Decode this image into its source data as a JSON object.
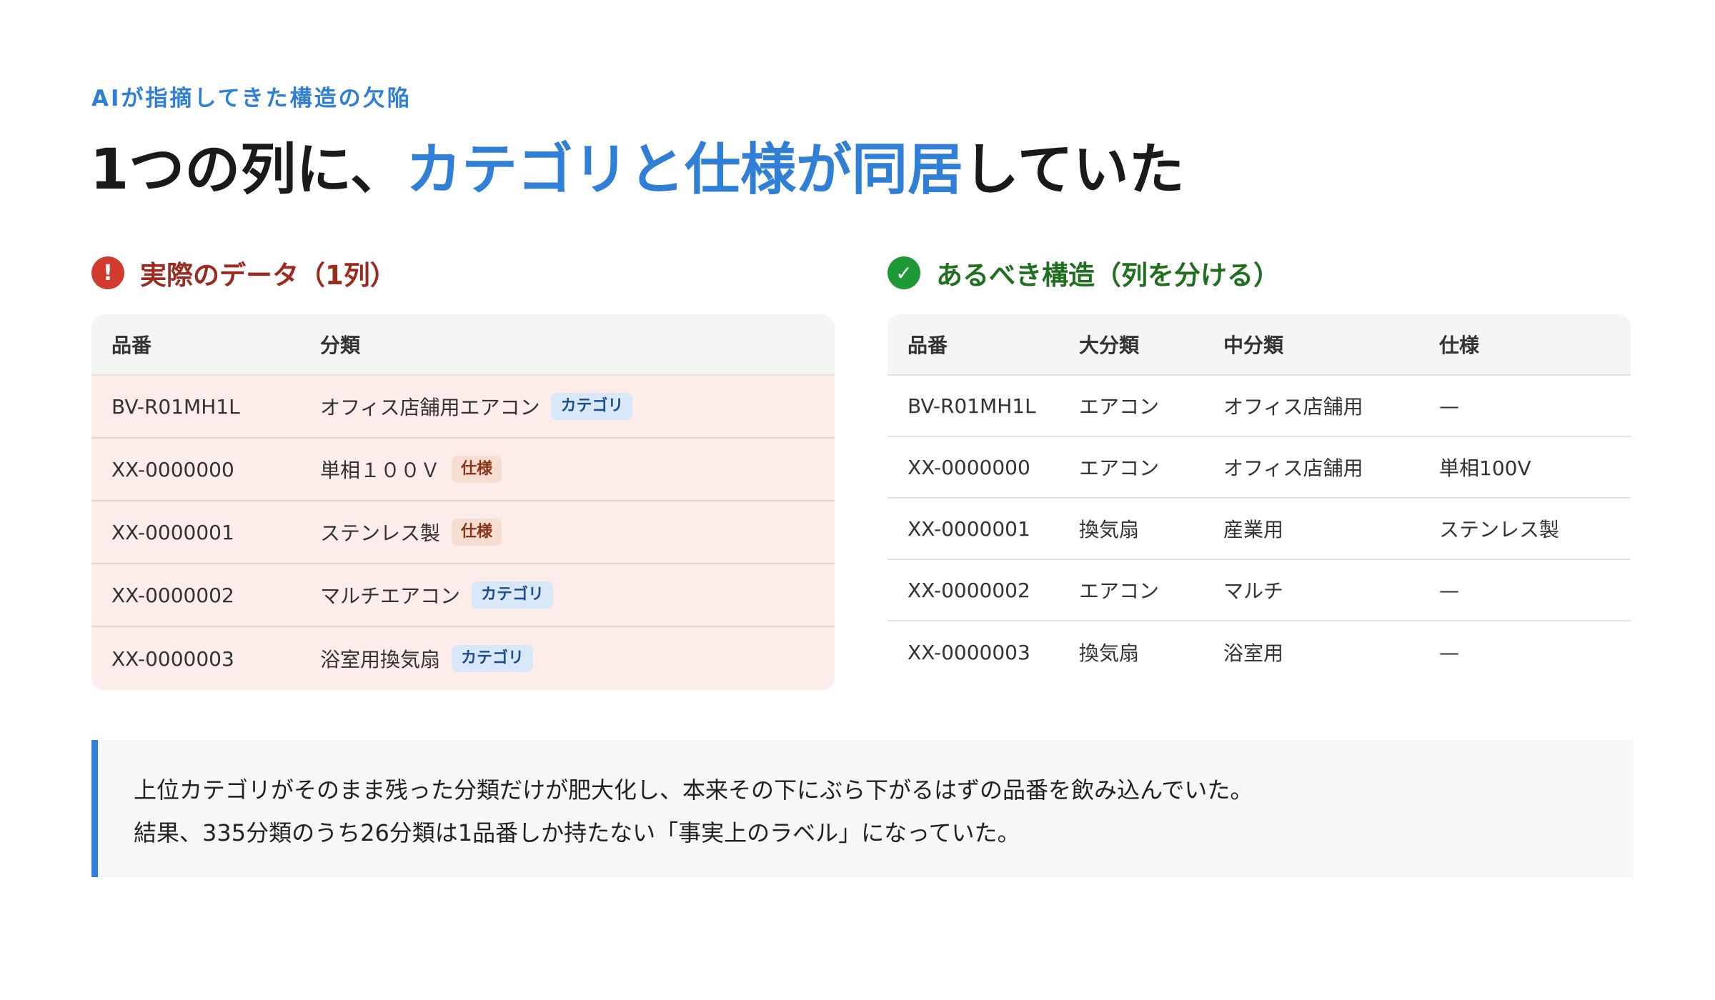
{
  "eyebrow": "AIが指摘してきた構造の欠陥",
  "headline": {
    "prefix": "1つの列に、",
    "accent": "カテゴリと仕様が同居",
    "suffix": "していた"
  },
  "colors": {
    "accent_blue": "#2f7fd6",
    "bad_red": "#d13b2e",
    "good_green": "#1d9a36",
    "bad_row_bg": "#fcecea"
  },
  "left_panel": {
    "icon": "exclamation-icon",
    "icon_glyph": "!",
    "title": "実際のデータ（1列）",
    "headers": [
      "品番",
      "分類"
    ],
    "rows": [
      {
        "code": "BV-R01MH1L",
        "class": "オフィス店舗用エアコン",
        "tag": "カテゴリ"
      },
      {
        "code": "XX-0000000",
        "class": "単相１００Ｖ",
        "tag": "仕様"
      },
      {
        "code": "XX-0000001",
        "class": "ステンレス製",
        "tag": "仕様"
      },
      {
        "code": "XX-0000002",
        "class": "マルチエアコン",
        "tag": "カテゴリ"
      },
      {
        "code": "XX-0000003",
        "class": "浴室用換気扇",
        "tag": "カテゴリ"
      }
    ]
  },
  "right_panel": {
    "icon": "check-icon",
    "icon_glyph": "✓",
    "title": "あるべき構造（列を分ける）",
    "headers": [
      "品番",
      "大分類",
      "中分類",
      "仕様"
    ],
    "rows": [
      {
        "code": "BV-R01MH1L",
        "major": "エアコン",
        "middle": "オフィス店舗用",
        "spec": "—"
      },
      {
        "code": "XX-0000000",
        "major": "エアコン",
        "middle": "オフィス店舗用",
        "spec": "単相100V"
      },
      {
        "code": "XX-0000001",
        "major": "換気扇",
        "middle": "産業用",
        "spec": "ステンレス製"
      },
      {
        "code": "XX-0000002",
        "major": "エアコン",
        "middle": "マルチ",
        "spec": "—"
      },
      {
        "code": "XX-0000003",
        "major": "換気扇",
        "middle": "浴室用",
        "spec": "—"
      }
    ]
  },
  "callout": {
    "line1": "上位カテゴリがそのまま残った分類だけが肥大化し、本来その下にぶら下がるはずの品番を飲み込んでいた。",
    "line2": "結果、335分類のうち26分類は1品番しか持たない「事実上のラベル」になっていた。"
  }
}
